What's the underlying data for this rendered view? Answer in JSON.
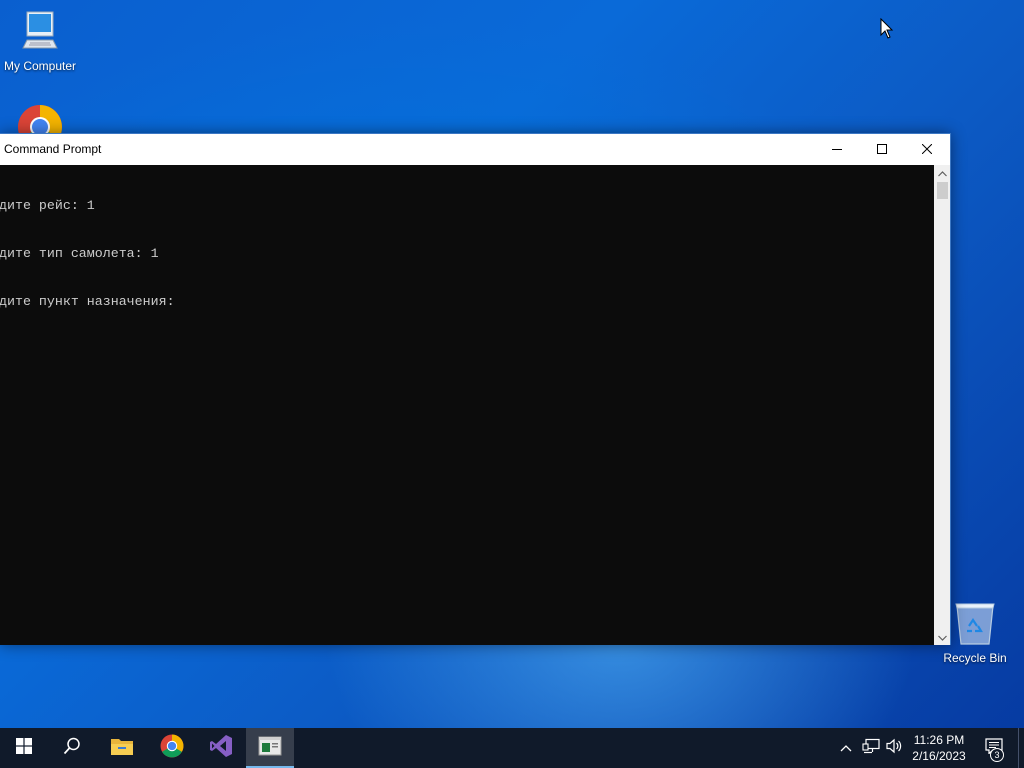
{
  "desktop": {
    "icons": [
      {
        "label": "My Computer",
        "icon": "computer-icon"
      },
      {
        "label": "",
        "icon": "chrome-icon"
      },
      {
        "label": "Recycle Bin",
        "icon": "recycle-bin-icon"
      }
    ]
  },
  "window": {
    "title": "Command Prompt",
    "console_lines": [
      "дите рейс: 1",
      "дите тип самолета: 1",
      "дите пункт назначения:"
    ],
    "controls": {
      "minimize": "minimize-icon",
      "maximize": "maximize-icon",
      "close": "close-icon"
    }
  },
  "taskbar": {
    "items": [
      "start",
      "search",
      "file-explorer",
      "chrome",
      "visual-studio",
      "command-prompt"
    ],
    "active_item": "command-prompt",
    "clock": {
      "time": "11:26 PM",
      "date": "2/16/2023"
    },
    "notification_count": "3"
  },
  "colors": {
    "console_bg": "#0c0c0c",
    "console_text": "#cccccc",
    "taskbar_bg": "#101a2a",
    "accent": "#76b9ed"
  }
}
